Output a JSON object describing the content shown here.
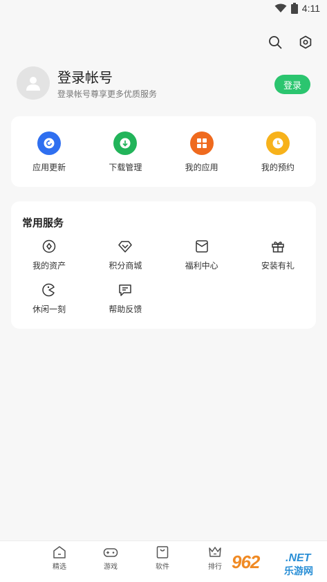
{
  "status_bar": {
    "time": "4:11",
    "icons": [
      "wifi-icon",
      "battery-icon"
    ]
  },
  "header": {
    "actions": [
      "search-icon",
      "settings-icon"
    ]
  },
  "profile": {
    "title": "登录帐号",
    "subtitle": "登录帐号尊享更多优质服务",
    "login_label": "登录",
    "accent": "#2bc56f"
  },
  "quick_actions": [
    {
      "label": "应用更新",
      "icon": "refresh-icon",
      "color": "#2f6ff0"
    },
    {
      "label": "下载管理",
      "icon": "download-icon",
      "color": "#22b45a"
    },
    {
      "label": "我的应用",
      "icon": "apps-grid-icon",
      "color": "#ef6a1e"
    },
    {
      "label": "我的预约",
      "icon": "clock-icon",
      "color": "#f7b21b"
    }
  ],
  "services": {
    "title": "常用服务",
    "items": [
      {
        "label": "我的资产",
        "icon": "coin-icon"
      },
      {
        "label": "积分商城",
        "icon": "diamond-icon"
      },
      {
        "label": "福利中心",
        "icon": "envelope-icon"
      },
      {
        "label": "安装有礼",
        "icon": "gift-icon"
      },
      {
        "label": "休闲一刻",
        "icon": "game-face-icon"
      },
      {
        "label": "帮助反馈",
        "icon": "feedback-icon"
      }
    ]
  },
  "bottom_nav": {
    "items": [
      {
        "label": "精选",
        "icon": "home-icon"
      },
      {
        "label": "游戏",
        "icon": "gamepad-icon"
      },
      {
        "label": "软件",
        "icon": "bag-icon"
      },
      {
        "label": "排行",
        "icon": "crown-icon"
      }
    ]
  },
  "watermark": {
    "logo": "962",
    "net": ".NET",
    "text": "乐游网"
  }
}
